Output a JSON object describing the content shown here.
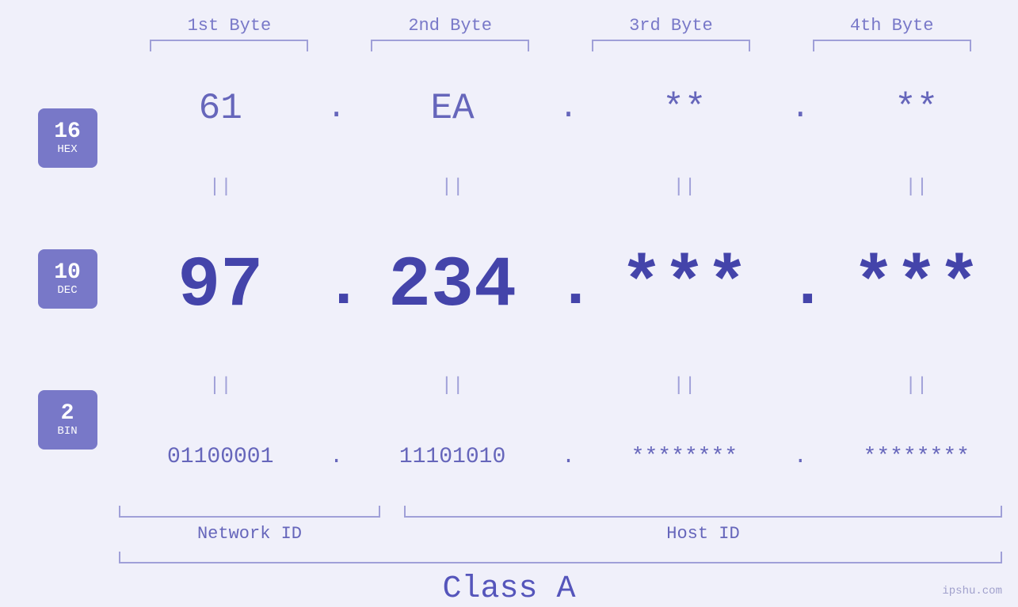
{
  "header": {
    "byte1": "1st Byte",
    "byte2": "2nd Byte",
    "byte3": "3rd Byte",
    "byte4": "4th Byte"
  },
  "badges": {
    "hex": {
      "num": "16",
      "label": "HEX"
    },
    "dec": {
      "num": "10",
      "label": "DEC"
    },
    "bin": {
      "num": "2",
      "label": "BIN"
    }
  },
  "hex_row": {
    "b1": "61",
    "b2": "EA",
    "b3": "**",
    "b4": "**",
    "dot": "."
  },
  "dec_row": {
    "b1": "97",
    "b2": "234",
    "b3": "***",
    "b4": "***",
    "dot": "."
  },
  "bin_row": {
    "b1": "01100001",
    "b2": "11101010",
    "b3": "********",
    "b4": "********",
    "dot": "."
  },
  "labels": {
    "network_id": "Network ID",
    "host_id": "Host ID",
    "class": "Class A"
  },
  "watermark": "ipshu.com"
}
